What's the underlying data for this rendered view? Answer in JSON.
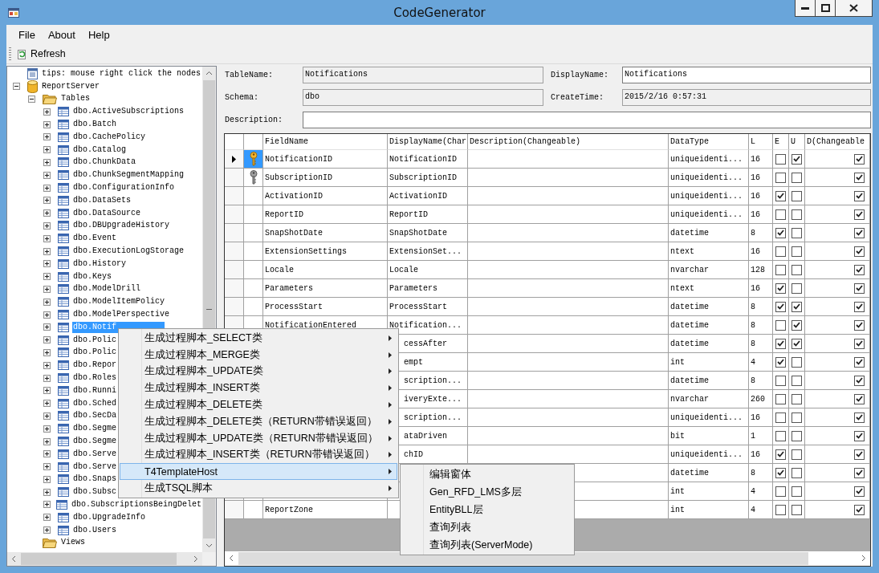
{
  "window": {
    "title": "CodeGenerator"
  },
  "menu_bar": [
    "File",
    "About",
    "Help"
  ],
  "toolbar": [
    {
      "label": "Refresh"
    }
  ],
  "tree": [
    {
      "kind": "note",
      "label": "tips: mouse right click the nodes",
      "selected": false
    },
    {
      "kind": "database",
      "label": "ReportServer",
      "expanded": true,
      "selected": false,
      "children": [
        {
          "kind": "folder",
          "label": "Tables",
          "expanded": true,
          "selected": false,
          "children": [
            {
              "kind": "table",
              "label": "dbo.ActiveSubscriptions",
              "expanded": false,
              "selected": false
            },
            {
              "kind": "table",
              "label": "dbo.Batch",
              "expanded": false,
              "selected": false
            },
            {
              "kind": "table",
              "label": "dbo.CachePolicy",
              "expanded": false,
              "selected": false
            },
            {
              "kind": "table",
              "label": "dbo.Catalog",
              "expanded": false,
              "selected": false
            },
            {
              "kind": "table",
              "label": "dbo.ChunkData",
              "expanded": false,
              "selected": false
            },
            {
              "kind": "table",
              "label": "dbo.ChunkSegmentMapping",
              "expanded": false,
              "selected": false
            },
            {
              "kind": "table",
              "label": "dbo.ConfigurationInfo",
              "expanded": false,
              "selected": false
            },
            {
              "kind": "table",
              "label": "dbo.DataSets",
              "expanded": false,
              "selected": false
            },
            {
              "kind": "table",
              "label": "dbo.DataSource",
              "expanded": false,
              "selected": false
            },
            {
              "kind": "table",
              "label": "dbo.DBUpgradeHistory",
              "expanded": false,
              "selected": false
            },
            {
              "kind": "table",
              "label": "dbo.Event",
              "expanded": false,
              "selected": false
            },
            {
              "kind": "table",
              "label": "dbo.ExecutionLogStorage",
              "expanded": false,
              "selected": false
            },
            {
              "kind": "table",
              "label": "dbo.History",
              "expanded": false,
              "selected": false
            },
            {
              "kind": "table",
              "label": "dbo.Keys",
              "expanded": false,
              "selected": false
            },
            {
              "kind": "table",
              "label": "dbo.ModelDrill",
              "expanded": false,
              "selected": false
            },
            {
              "kind": "table",
              "label": "dbo.ModelItemPolicy",
              "expanded": false,
              "selected": false
            },
            {
              "kind": "table",
              "label": "dbo.ModelPerspective",
              "expanded": false,
              "selected": false
            },
            {
              "kind": "table",
              "label": "dbo.Notif",
              "expanded": false,
              "selected": true
            },
            {
              "kind": "table",
              "label": "dbo.Polic",
              "expanded": false,
              "selected": false
            },
            {
              "kind": "table",
              "label": "dbo.Polic",
              "expanded": false,
              "selected": false
            },
            {
              "kind": "table",
              "label": "dbo.Repor",
              "expanded": false,
              "selected": false
            },
            {
              "kind": "table",
              "label": "dbo.Roles",
              "expanded": false,
              "selected": false
            },
            {
              "kind": "table",
              "label": "dbo.Runni",
              "expanded": false,
              "selected": false
            },
            {
              "kind": "table",
              "label": "dbo.Sched",
              "expanded": false,
              "selected": false
            },
            {
              "kind": "table",
              "label": "dbo.SecDa",
              "expanded": false,
              "selected": false
            },
            {
              "kind": "table",
              "label": "dbo.Segme",
              "expanded": false,
              "selected": false
            },
            {
              "kind": "table",
              "label": "dbo.Segme",
              "expanded": false,
              "selected": false
            },
            {
              "kind": "table",
              "label": "dbo.Serve",
              "expanded": false,
              "selected": false
            },
            {
              "kind": "table",
              "label": "dbo.Serve",
              "expanded": false,
              "selected": false
            },
            {
              "kind": "table",
              "label": "dbo.Snaps",
              "expanded": false,
              "selected": false
            },
            {
              "kind": "table",
              "label": "dbo.Subsc",
              "expanded": false,
              "selected": false
            },
            {
              "kind": "table",
              "label": "dbo.SubscriptionsBeingDelet",
              "expanded": false,
              "selected": false
            },
            {
              "kind": "table",
              "label": "dbo.UpgradeInfo",
              "expanded": false,
              "selected": false
            },
            {
              "kind": "table",
              "label": "dbo.Users",
              "expanded": false,
              "selected": false
            }
          ]
        },
        {
          "kind": "folder",
          "label": "Views",
          "selected": false
        }
      ]
    }
  ],
  "form": {
    "fields": [
      {
        "label": "TableName:",
        "value": "Notifications",
        "disabled": true
      },
      {
        "label": "DisplayName:",
        "value": "Notifications",
        "disabled": false
      },
      {
        "label": "Schema:",
        "value": "dbo",
        "disabled": true
      },
      {
        "label": "CreateTime:",
        "value": "2015/2/16 0:57:31",
        "disabled": true
      },
      {
        "label": "Description:",
        "disabled": false
      }
    ]
  },
  "table": {
    "columns": [
      "FieldName",
      "DisplayName(Char",
      "Description(Changeable)",
      "DataType",
      "L",
      "E",
      "U",
      "D(Changeable"
    ],
    "rows": [
      {
        "field": "NotificationID",
        "display": "NotificationID",
        "datatype": "uniqueidenti...",
        "length": "16",
        "e": false,
        "u": true,
        "d": true,
        "kind": "primary_key",
        "current": true,
        "selected": true
      },
      {
        "field": "SubscriptionID",
        "display": "SubscriptionID",
        "datatype": "uniqueidenti...",
        "length": "16",
        "e": false,
        "u": false,
        "d": true,
        "kind": "foreign_key",
        "current": false,
        "selected": false
      },
      {
        "field": "ActivationID",
        "display": "ActivationID",
        "datatype": "uniqueidenti...",
        "length": "16",
        "e": true,
        "u": false,
        "d": true,
        "current": false,
        "selected": false
      },
      {
        "field": "ReportID",
        "display": "ReportID",
        "datatype": "uniqueidenti...",
        "length": "16",
        "e": false,
        "u": false,
        "d": true,
        "current": false,
        "selected": false
      },
      {
        "field": "SnapShotDate",
        "display": "SnapShotDate",
        "datatype": "datetime",
        "length": "8",
        "e": true,
        "u": false,
        "d": true,
        "current": false,
        "selected": false
      },
      {
        "field": "ExtensionSettings",
        "display": "ExtensionSet...",
        "datatype": "ntext",
        "length": "16",
        "e": false,
        "u": false,
        "d": true,
        "current": false,
        "selected": false
      },
      {
        "field": "Locale",
        "display": "Locale",
        "datatype": "nvarchar",
        "length": "128",
        "e": false,
        "u": false,
        "d": true,
        "current": false,
        "selected": false
      },
      {
        "field": "Parameters",
        "display": "Parameters",
        "datatype": "ntext",
        "length": "16",
        "e": true,
        "u": false,
        "d": true,
        "current": false,
        "selected": false
      },
      {
        "field": "ProcessStart",
        "display": "ProcessStart",
        "datatype": "datetime",
        "length": "8",
        "e": true,
        "u": true,
        "d": true,
        "current": false,
        "selected": false
      },
      {
        "field": "NotificationEntered",
        "display": "Notification...",
        "datatype": "datetime",
        "length": "8",
        "e": false,
        "u": true,
        "d": true,
        "current": false,
        "selected": false
      },
      {
        "display": "cessAfter",
        "datatype": "datetime",
        "length": "8",
        "e": true,
        "u": true,
        "d": true
      },
      {
        "display": "empt",
        "datatype": "int",
        "length": "4",
        "e": true,
        "u": false,
        "d": true
      },
      {
        "display": "scription...",
        "datatype": "datetime",
        "length": "8",
        "e": false,
        "u": false,
        "d": true
      },
      {
        "display": "iveryExte...",
        "datatype": "nvarchar",
        "length": "260",
        "e": false,
        "u": false,
        "d": true
      },
      {
        "display": "scription...",
        "datatype": "uniqueidenti...",
        "length": "16",
        "e": false,
        "u": false,
        "d": true
      },
      {
        "display": "ataDriven",
        "datatype": "bit",
        "length": "1",
        "e": false,
        "u": false,
        "d": true
      },
      {
        "display": "chID",
        "datatype": "uniqueidenti...",
        "length": "16",
        "e": true,
        "u": false,
        "d": true
      },
      {
        "datatype": "datetime",
        "length": "8",
        "e": true,
        "u": false,
        "d": true
      },
      {
        "datatype": "int",
        "length": "4",
        "e": false,
        "u": false,
        "d": true
      },
      {
        "field": "ReportZone",
        "datatype": "int",
        "length": "4",
        "e": false,
        "u": false,
        "d": true,
        "current": false,
        "selected": false
      }
    ]
  },
  "context_menu": {
    "items": [
      {
        "label": "生成过程脚本_SELECT类",
        "has_submenu": true,
        "selected": false
      },
      {
        "label": "生成过程脚本_MERGE类",
        "has_submenu": true,
        "selected": false
      },
      {
        "label": "生成过程脚本_UPDATE类",
        "has_submenu": true,
        "selected": false
      },
      {
        "label": "生成过程脚本_INSERT类",
        "has_submenu": true,
        "selected": false
      },
      {
        "label": "生成过程脚本_DELETE类",
        "has_submenu": true,
        "selected": false
      },
      {
        "label": "生成过程脚本_DELETE类（RETURN带错误返回）",
        "has_submenu": true,
        "selected": false
      },
      {
        "label": "生成过程脚本_UPDATE类（RETURN带错误返回）",
        "has_submenu": true,
        "selected": false
      },
      {
        "label": "生成过程脚本_INSERT类（RETURN带错误返回）",
        "has_submenu": true,
        "selected": false
      },
      {
        "label": "T4TemplateHost",
        "has_submenu": true,
        "selected": true
      },
      {
        "label": "生成TSQL脚本",
        "has_submenu": true,
        "selected": false
      }
    ],
    "submenu": [
      {
        "label": "编辑窗体"
      },
      {
        "label": "Gen_RFD_LMS多层"
      },
      {
        "label": "EntityBLL层"
      },
      {
        "label": "查询列表"
      },
      {
        "label": "查询列表(ServerMode)"
      }
    ]
  }
}
